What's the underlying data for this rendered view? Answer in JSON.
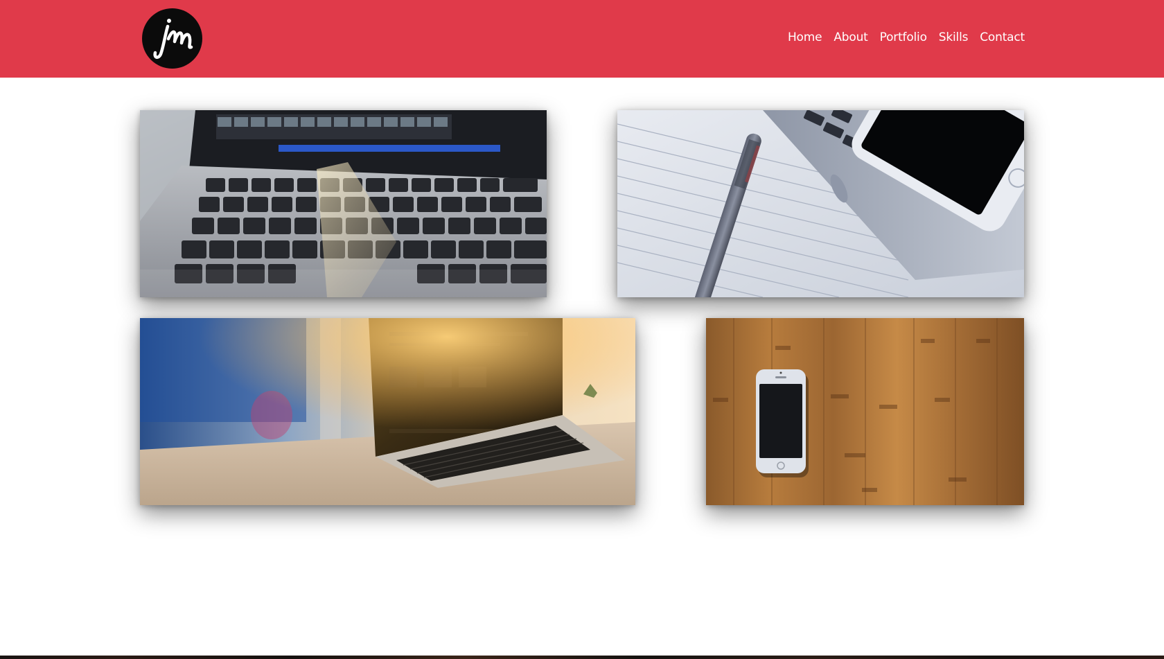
{
  "header": {
    "background_color": "#e03a4a",
    "logo": {
      "icon": "jm-monogram-logo",
      "text": "JM"
    }
  },
  "nav": {
    "items": [
      {
        "label": "Home"
      },
      {
        "label": "About"
      },
      {
        "label": "Portfolio"
      },
      {
        "label": "Skills"
      },
      {
        "label": "Contact"
      }
    ]
  },
  "gallery": {
    "items": [
      {
        "subject": "laptop-keyboard-photo"
      },
      {
        "subject": "notebook-pen-phone-photo"
      },
      {
        "subject": "laptop-sunlight-photo"
      },
      {
        "subject": "phone-on-wood-photo"
      }
    ]
  }
}
